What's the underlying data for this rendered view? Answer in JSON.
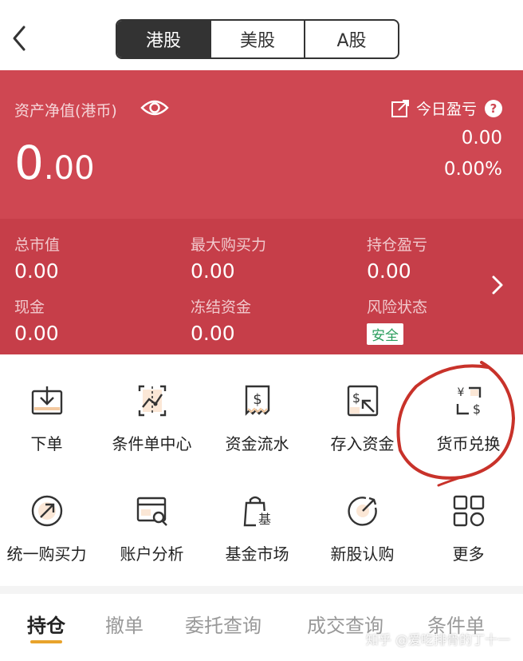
{
  "header": {
    "tabs": [
      "港股",
      "美股",
      "A股"
    ],
    "active_tab": "港股"
  },
  "account": {
    "net_value_label": "资产净值(港币)",
    "net_value_int": "0",
    "net_value_dec": ".00",
    "today_pnl_label": "今日盈亏",
    "today_pnl_value": "0.00",
    "today_pnl_percent": "0.00%",
    "stats": [
      {
        "label": "总市值",
        "value": "0.00"
      },
      {
        "label": "最大购买力",
        "value": "0.00"
      },
      {
        "label": "持仓盈亏",
        "value": "0.00"
      },
      {
        "label": "现金",
        "value": "0.00"
      },
      {
        "label": "冻结资金",
        "value": "0.00"
      },
      {
        "label": "风险状态",
        "value": "安全"
      }
    ]
  },
  "functions": [
    {
      "label": "下单",
      "icon": "download-tray-icon"
    },
    {
      "label": "条件单中心",
      "icon": "conditional-order-icon"
    },
    {
      "label": "资金流水",
      "icon": "fund-flow-icon"
    },
    {
      "label": "存入资金",
      "icon": "deposit-icon"
    },
    {
      "label": "货币兑换",
      "icon": "currency-exchange-icon"
    },
    {
      "label": "统一购买力",
      "icon": "purchasing-power-icon"
    },
    {
      "label": "账户分析",
      "icon": "account-analysis-icon"
    },
    {
      "label": "基金市场",
      "icon": "fund-market-icon"
    },
    {
      "label": "新股认购",
      "icon": "ipo-subscription-icon"
    },
    {
      "label": "更多",
      "icon": "more-grid-icon"
    }
  ],
  "bottom_tabs": [
    "持仓",
    "撤单",
    "委托查询",
    "成交查询",
    "条件单"
  ],
  "watermark": "知乎 @爱吃排骨的丁十一",
  "colors": {
    "card_red": "#cf4752",
    "card_red_dark": "#c63e49",
    "accent_orange": "#e8a32c",
    "annotation_red": "#c8322a",
    "safe_green": "#2a9d5c"
  }
}
